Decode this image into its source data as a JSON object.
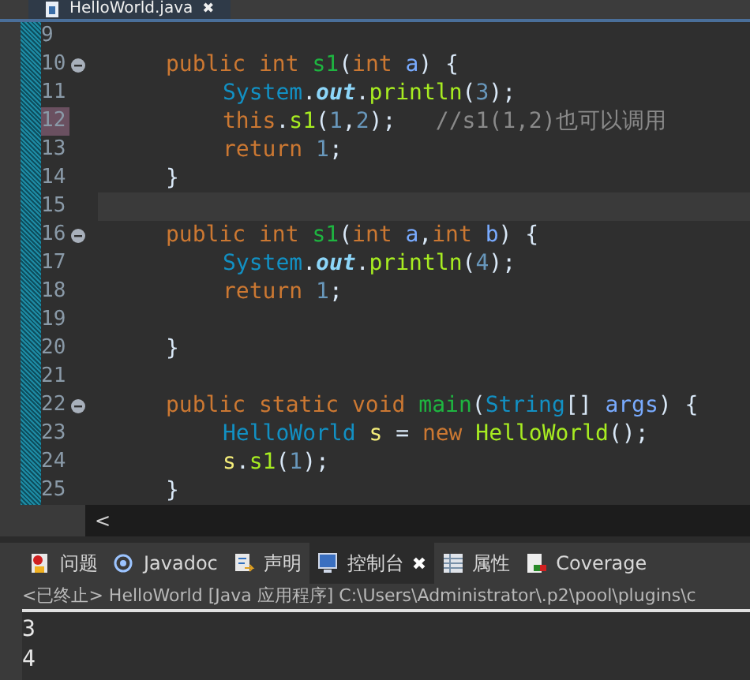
{
  "editor_tab": {
    "title": "HelloWorld.java",
    "close": "✖",
    "selected": true
  },
  "lines": [
    {
      "number": "9",
      "fold": false,
      "marked": false,
      "current": false
    },
    {
      "number": "10",
      "fold": true,
      "marked": false,
      "current": false,
      "tokens": [
        {
          "kind": "keyword",
          "text": "public int "
        },
        {
          "kind": "decl",
          "text": "s1"
        },
        {
          "kind": "plain",
          "text": "("
        },
        {
          "kind": "keyword",
          "text": "int "
        },
        {
          "kind": "param",
          "text": "a"
        },
        {
          "kind": "plain",
          "text": ") {"
        }
      ],
      "children": [
        {
          "number": "11",
          "fold": false,
          "marked": false,
          "current": false,
          "tokens": [
            {
              "kind": "type",
              "text": "System"
            },
            {
              "kind": "plain",
              "text": "."
            },
            {
              "kind": "field",
              "text": "out"
            },
            {
              "kind": "plain",
              "text": "."
            },
            {
              "kind": "call",
              "text": "println"
            },
            {
              "kind": "plain",
              "text": "("
            },
            {
              "kind": "number",
              "text": "3"
            },
            {
              "kind": "plain",
              "text": ");"
            }
          ]
        },
        {
          "number": "12",
          "fold": false,
          "marked": true,
          "current": false,
          "tokens": [
            {
              "kind": "keyword",
              "text": "this"
            },
            {
              "kind": "plain",
              "text": "."
            },
            {
              "kind": "call",
              "text": "s1"
            },
            {
              "kind": "plain",
              "text": "("
            },
            {
              "kind": "number",
              "text": "1"
            },
            {
              "kind": "plain",
              "text": ","
            },
            {
              "kind": "number",
              "text": "2"
            },
            {
              "kind": "plain",
              "text": ");   "
            },
            {
              "kind": "comment",
              "text": "//s1(1,2)也可以调用"
            }
          ]
        },
        {
          "number": "13",
          "fold": false,
          "marked": false,
          "current": false,
          "tokens": [
            {
              "kind": "keyword",
              "text": "return "
            },
            {
              "kind": "number",
              "text": "1"
            },
            {
              "kind": "plain",
              "text": ";"
            }
          ]
        }
      ]
    },
    {
      "number": "14",
      "fold": false,
      "marked": false,
      "current": false,
      "tokens": [
        {
          "kind": "plain",
          "text": "}"
        }
      ]
    },
    {
      "number": "15",
      "fold": false,
      "marked": false,
      "current": true
    },
    {
      "number": "16",
      "fold": true,
      "marked": false,
      "current": false,
      "tokens": [
        {
          "kind": "keyword",
          "text": "public int "
        },
        {
          "kind": "decl",
          "text": "s1"
        },
        {
          "kind": "plain",
          "text": "("
        },
        {
          "kind": "keyword",
          "text": "int "
        },
        {
          "kind": "param",
          "text": "a"
        },
        {
          "kind": "plain",
          "text": ","
        },
        {
          "kind": "keyword",
          "text": "int "
        },
        {
          "kind": "param",
          "text": "b"
        },
        {
          "kind": "plain",
          "text": ") {"
        }
      ],
      "children": [
        {
          "number": "17",
          "fold": false,
          "marked": false,
          "current": false,
          "tokens": [
            {
              "kind": "type",
              "text": "System"
            },
            {
              "kind": "plain",
              "text": "."
            },
            {
              "kind": "field",
              "text": "out"
            },
            {
              "kind": "plain",
              "text": "."
            },
            {
              "kind": "call",
              "text": "println"
            },
            {
              "kind": "plain",
              "text": "("
            },
            {
              "kind": "number",
              "text": "4"
            },
            {
              "kind": "plain",
              "text": ");"
            }
          ]
        },
        {
          "number": "18",
          "fold": false,
          "marked": false,
          "current": false,
          "tokens": [
            {
              "kind": "keyword",
              "text": "return "
            },
            {
              "kind": "number",
              "text": "1"
            },
            {
              "kind": "plain",
              "text": ";"
            }
          ]
        },
        {
          "number": "19",
          "fold": false,
          "marked": false,
          "current": false
        }
      ]
    },
    {
      "number": "20",
      "fold": false,
      "marked": false,
      "current": false,
      "tokens": [
        {
          "kind": "plain",
          "text": "}"
        }
      ]
    },
    {
      "number": "21",
      "fold": false,
      "marked": false,
      "current": false
    },
    {
      "number": "22",
      "fold": true,
      "marked": false,
      "current": false,
      "tokens": [
        {
          "kind": "keyword",
          "text": "public static void "
        },
        {
          "kind": "decl",
          "text": "main"
        },
        {
          "kind": "plain",
          "text": "("
        },
        {
          "kind": "type",
          "text": "String"
        },
        {
          "kind": "plain",
          "text": "[] "
        },
        {
          "kind": "param",
          "text": "args"
        },
        {
          "kind": "plain",
          "text": ") {"
        }
      ],
      "children": [
        {
          "number": "23",
          "fold": false,
          "marked": false,
          "current": false,
          "tokens": [
            {
              "kind": "type",
              "text": "HelloWorld "
            },
            {
              "kind": "local",
              "text": "s"
            },
            {
              "kind": "plain",
              "text": " = "
            },
            {
              "kind": "keyword",
              "text": "new "
            },
            {
              "kind": "call",
              "text": "HelloWorld"
            },
            {
              "kind": "plain",
              "text": "();"
            }
          ]
        },
        {
          "number": "24",
          "fold": false,
          "marked": false,
          "current": false,
          "tokens": [
            {
              "kind": "local",
              "text": "s"
            },
            {
              "kind": "plain",
              "text": "."
            },
            {
              "kind": "call",
              "text": "s1"
            },
            {
              "kind": "plain",
              "text": "("
            },
            {
              "kind": "number",
              "text": "1"
            },
            {
              "kind": "plain",
              "text": ");"
            }
          ]
        }
      ]
    },
    {
      "number": "25",
      "fold": false,
      "marked": false,
      "current": false,
      "tokens": [
        {
          "kind": "plain",
          "text": "}"
        }
      ]
    }
  ],
  "scroll_left": "<",
  "views": [
    {
      "label": "问题",
      "selected": false
    },
    {
      "label": "Javadoc",
      "selected": false
    },
    {
      "label": "声明",
      "selected": false
    },
    {
      "label": "控制台",
      "selected": true,
      "close": "✖"
    },
    {
      "label": "属性",
      "selected": false
    },
    {
      "label": "Coverage",
      "selected": false
    }
  ],
  "console": {
    "header": "<已终止> HelloWorld [Java 应用程序] C:\\Users\\Administrator\\.p2\\pool\\plugins\\c",
    "output": [
      "3",
      "4"
    ]
  }
}
